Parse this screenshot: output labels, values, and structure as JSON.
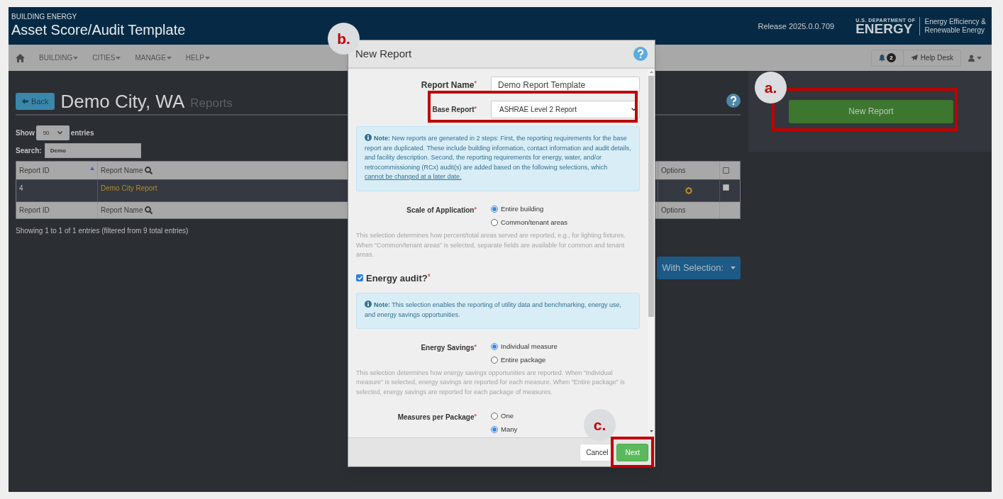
{
  "header": {
    "kicker": "BUILDING ENERGY",
    "title": "Asset Score/Audit Template",
    "release": "Release 2025.0.0.709",
    "logo_small": "U.S. DEPARTMENT OF",
    "logo_big": "ENERGY",
    "logo_line1": "Energy Efficiency &",
    "logo_line2": "Renewable Energy"
  },
  "nav": {
    "items": [
      "BUILDING",
      "CITIES",
      "MANAGE",
      "HELP"
    ],
    "notifications": "2",
    "help_desk": "Help Desk"
  },
  "page": {
    "back": "Back",
    "title": "Demo City, WA",
    "subtitle": "Reports",
    "show_label": "Show",
    "page_size": "50",
    "entries_label": "entries",
    "search_label": "Search:",
    "search_value": "Demo",
    "table": {
      "columns": [
        "Report ID",
        "Report Name",
        "Options"
      ],
      "select_all_checked": false,
      "rows": [
        {
          "id": "4",
          "name": "Demo City Report",
          "checked": false
        }
      ],
      "footer": [
        "Report ID",
        "Report Name",
        "Options"
      ]
    },
    "info": "Showing 1 to 1 of 1 entries (filtered from 9 total entries)",
    "with_selection": "With Selection:"
  },
  "side": {
    "new_report": "New Report"
  },
  "modal": {
    "title": "New Report",
    "report_name": {
      "label": "Report Name",
      "mark": "*",
      "value": "Demo Report Template"
    },
    "base_report": {
      "label": "Base Report",
      "mark": "*",
      "value": "ASHRAE Level 2 Report"
    },
    "note1": {
      "text": "**Note:** New reports are generated in 2 steps: First, the reporting requirements for the base report are duplicated. These include building information, contact information and audit details, and facility description. Second, the reporting requirements for energy, water, and/or retrocommissioning (RCx) audit(s) are added based on the following selections, which ",
      "link": "cannot be changed at a later date."
    },
    "scale": {
      "label": "Scale of Application",
      "mark": "*",
      "options": [
        {
          "label": "Entire building",
          "selected": true
        },
        {
          "label": "Common/tenant areas",
          "selected": false
        }
      ],
      "help": "This selection determines how percent/total areas served are reported, e.g., for lighting fixtures. When “Common/tenant areas” is selected, separate fields are available for common and tenant areas."
    },
    "energy_audit": {
      "label": "Energy audit?",
      "mark": "*",
      "checked": true
    },
    "note2": {
      "text": "**Note:** This selection enables the reporting of utility data and benchmarking, energy use, and energy savings opportunities."
    },
    "savings": {
      "label": "Energy Savings",
      "mark": "*",
      "options": [
        {
          "label": "Individual measure",
          "selected": true
        },
        {
          "label": "Entire package",
          "selected": false
        }
      ],
      "help": "This selection determines how energy savings opportunities are reported. When “Individual measure” is selected, energy savings are reported for each measure. When “Entire package” is selected, energy savings are reported for each package of measures."
    },
    "measures": {
      "label": "Measures per Package",
      "mark": "*",
      "options": [
        {
          "label": "One",
          "selected": false
        },
        {
          "label": "Many",
          "selected": true
        }
      ]
    },
    "cancel": "Cancel",
    "next": "Next"
  },
  "callouts": [
    {
      "label": "a."
    },
    {
      "label": "b."
    },
    {
      "label": "c."
    }
  ]
}
